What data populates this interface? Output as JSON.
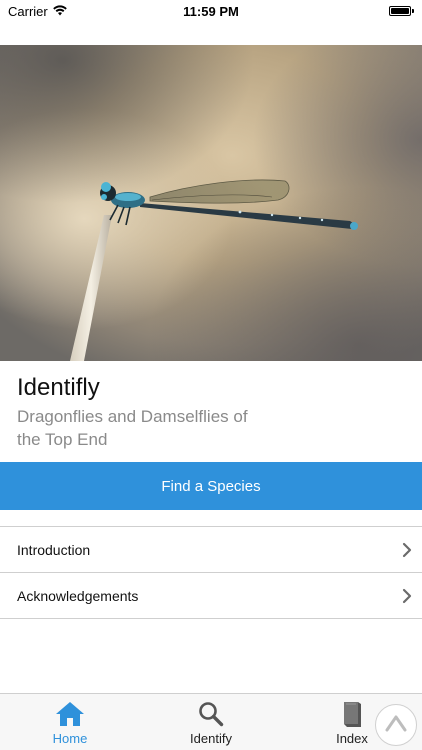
{
  "status_bar": {
    "carrier": "Carrier",
    "time": "11:59 PM"
  },
  "hero": {
    "image_subject": "damselfly perched on a reed"
  },
  "header": {
    "title": "Identifly",
    "subtitle": "Dragonflies and Damselflies of the Top End"
  },
  "actions": {
    "find_label": "Find a Species"
  },
  "menu": {
    "items": [
      {
        "label": "Introduction",
        "icon": "chevron-right-icon"
      },
      {
        "label": "Acknowledgements",
        "icon": "chevron-right-icon"
      }
    ]
  },
  "tab_bar": {
    "tabs": [
      {
        "label": "Home",
        "icon": "home-icon",
        "active": true
      },
      {
        "label": "Identify",
        "icon": "search-icon",
        "active": false
      },
      {
        "label": "Index",
        "icon": "book-icon",
        "active": false
      }
    ]
  },
  "colors": {
    "accent": "#2f91db",
    "active_tab": "#2f91db",
    "subtitle": "#8a8a8a",
    "divider": "#cfcfcf"
  }
}
